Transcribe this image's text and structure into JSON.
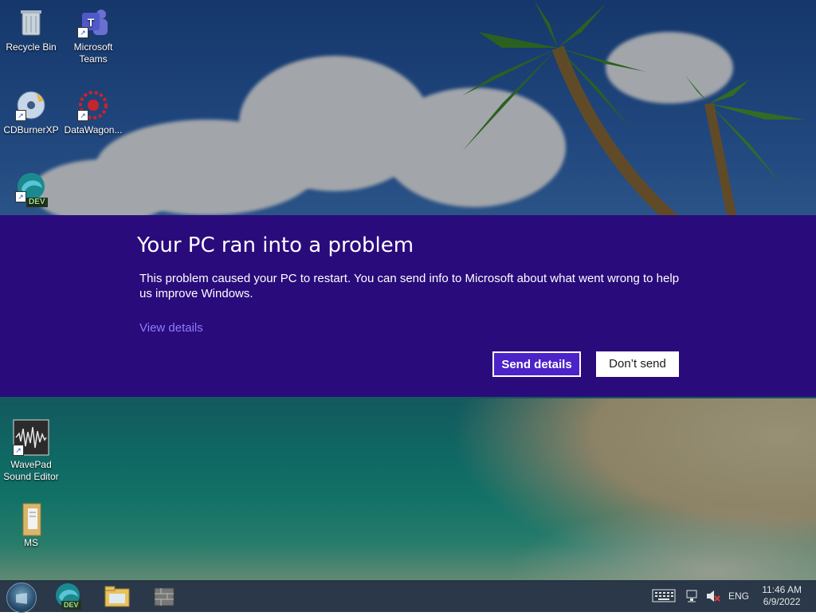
{
  "desktop": {
    "icons": [
      {
        "label": "Recycle Bin"
      },
      {
        "label": "Microsoft Teams"
      },
      {
        "label": "CDBurnerXP"
      },
      {
        "label": "DataWagon..."
      },
      {
        "label": "DEV"
      },
      {
        "label": "WavePad Sound Editor"
      },
      {
        "label": "MS"
      }
    ]
  },
  "dialog": {
    "title": "Your PC ran into a problem",
    "message": "This problem caused your PC to restart. You can send info to Microsoft about what went wrong to help us improve Windows.",
    "view_details": "View details",
    "send_button": "Send details",
    "dont_send_button": "Don’t send"
  },
  "taskbar": {
    "edge_dev_badge": "DEV",
    "language": "ENG",
    "time": "11:46 AM",
    "date": "6/9/2022"
  },
  "colors": {
    "dialog_bg": "#2a0b7c",
    "link": "#8f7cff",
    "send_button_bg": "#4b23c8"
  }
}
